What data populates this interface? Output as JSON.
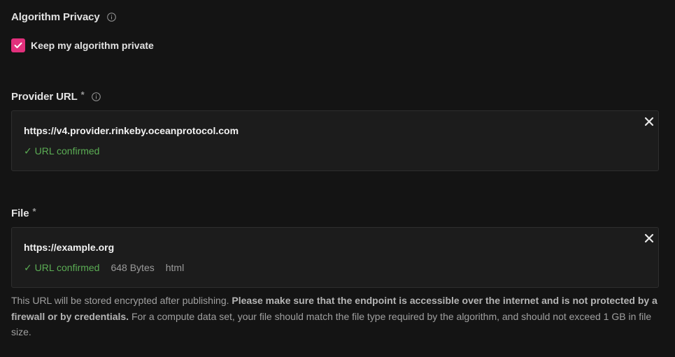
{
  "privacy": {
    "label": "Algorithm Privacy",
    "checkbox_label": "Keep my algorithm private",
    "checked": true,
    "accent_color": "#e2307c"
  },
  "provider": {
    "label": "Provider URL",
    "required_mark": "*",
    "url": "https://v4.provider.rinkeby.oceanprotocol.com",
    "status": "✓ URL confirmed"
  },
  "file": {
    "label": "File",
    "required_mark": "*",
    "url": "https://example.org",
    "status": "✓ URL confirmed",
    "size": "648 Bytes",
    "type": "html"
  },
  "help": {
    "normal_1": "This URL will be stored encrypted after publishing. ",
    "bold": "Please make sure that the endpoint is accessible over the internet and is not protected by a firewall or by credentials.",
    "normal_2": " For a compute data set, your file should match the file type required by the algorithm, and should not exceed 1 GB in file size."
  },
  "icons": {
    "info": "info-icon",
    "check": "check-icon",
    "close": "close-icon"
  },
  "colors": {
    "background": "#141414",
    "box_background": "#1c1c1c",
    "success": "#5bad54"
  }
}
